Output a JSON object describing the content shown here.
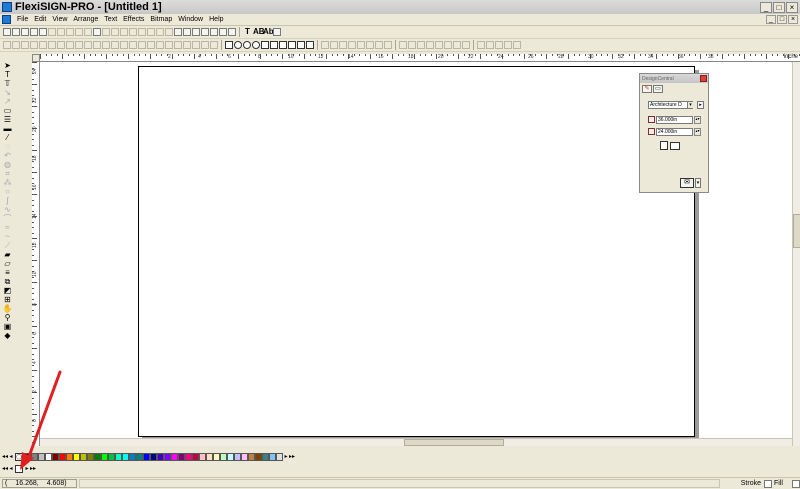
{
  "window": {
    "title": "FlexiSIGN-PRO - [Untitled 1]",
    "buttons": [
      "_",
      "□",
      "×"
    ]
  },
  "menu": {
    "items": [
      "File",
      "Edit",
      "View",
      "Arrange",
      "Text",
      "Effects",
      "Bitmap",
      "Window",
      "Help"
    ],
    "mdi_buttons": [
      "_",
      "□",
      "×"
    ]
  },
  "toolbar": {
    "text_tools": [
      "T",
      "AB",
      "Ab"
    ]
  },
  "ruler": {
    "unit": "inche",
    "top_labels": [
      "2",
      "4",
      "6",
      "8",
      "10",
      "12",
      "14",
      "16",
      "18",
      "20",
      "22",
      "24",
      "26",
      "28",
      "30",
      "32",
      "34",
      "36",
      "38"
    ],
    "left_labels": [
      "24",
      "22",
      "20",
      "18",
      "16",
      "14",
      "12",
      "10",
      "8",
      "6",
      "4",
      "2",
      "0"
    ]
  },
  "design_central": {
    "title": "DesignCentral",
    "media_select": "Architecture D",
    "width_value": "36.000in",
    "height_value": "24.000in"
  },
  "palette": {
    "colors": [
      "#000000",
      "#808080",
      "#c0c0c0",
      "#ffffff",
      "#800000",
      "#ff0000",
      "#ff8000",
      "#ffff00",
      "#c0c000",
      "#808000",
      "#008000",
      "#00ff00",
      "#00c040",
      "#00ffc0",
      "#00ffff",
      "#0080c0",
      "#008080",
      "#0000ff",
      "#000080",
      "#4000c0",
      "#8000ff",
      "#ff00ff",
      "#800080",
      "#ff0080",
      "#c00040",
      "#ffc0c0",
      "#ffe0c0",
      "#ffffc0",
      "#c0ffc0",
      "#c0ffff",
      "#c0c0ff",
      "#ffc0ff",
      "#c08040",
      "#804000",
      "#408080",
      "#80c0ff",
      "#e0e0e0"
    ]
  },
  "status": {
    "x": "16.268,",
    "y": "4.608)",
    "open_paren": "(",
    "stroke_label": "Stroke",
    "fill_label": "Fill"
  }
}
